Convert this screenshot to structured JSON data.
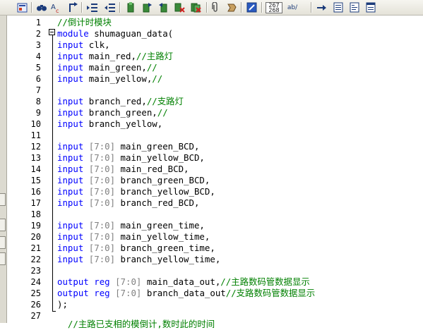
{
  "toolbar": {
    "buttons": [
      {
        "name": "compile-icon"
      },
      {
        "name": "find-icon"
      },
      {
        "name": "find-replace-icon"
      },
      {
        "name": "goto-icon"
      },
      {
        "name": "indent-icon"
      },
      {
        "name": "outdent-icon"
      },
      {
        "name": "bookmark-toggle-icon"
      },
      {
        "name": "bookmark-next-icon"
      },
      {
        "name": "bookmark-prev-icon"
      },
      {
        "name": "bookmark-clear-icon"
      },
      {
        "name": "bookmark-clear-all-icon"
      },
      {
        "name": "attach-icon"
      },
      {
        "name": "insert-icon"
      },
      {
        "name": "edit-icon"
      },
      {
        "name": "number-format-button",
        "text1": "267",
        "text2": "268"
      },
      {
        "name": "abbrev-button",
        "text": "ab/"
      },
      {
        "name": "arrow-right-icon"
      },
      {
        "name": "list-icon"
      },
      {
        "name": "list-alt-icon"
      },
      {
        "name": "doc-icon"
      }
    ]
  },
  "editor": {
    "line_numbers": [
      "1",
      "2",
      "3",
      "4",
      "5",
      "6",
      "7",
      "8",
      "9",
      "10",
      "11",
      "12",
      "13",
      "14",
      "15",
      "16",
      "17",
      "18",
      "19",
      "20",
      "21",
      "22",
      "23",
      "24",
      "25",
      "26",
      "27"
    ],
    "lines": [
      {
        "n": "1",
        "parts": [
          {
            "t": "//倒计时模块",
            "c": "cm"
          }
        ]
      },
      {
        "n": "2",
        "parts": [
          {
            "t": "module",
            "c": "kw"
          },
          {
            "t": " shumaguan_data(",
            "c": "ty"
          }
        ]
      },
      {
        "n": "3",
        "parts": [
          {
            "t": "input",
            "c": "kw"
          },
          {
            "t": " clk,",
            "c": "ty"
          }
        ]
      },
      {
        "n": "4",
        "parts": [
          {
            "t": "input",
            "c": "kw"
          },
          {
            "t": " main_red,",
            "c": "ty"
          },
          {
            "t": "//主路灯",
            "c": "cm"
          }
        ]
      },
      {
        "n": "5",
        "parts": [
          {
            "t": "input",
            "c": "kw"
          },
          {
            "t": " main_green,",
            "c": "ty"
          },
          {
            "t": "//",
            "c": "cm"
          }
        ]
      },
      {
        "n": "6",
        "parts": [
          {
            "t": "input",
            "c": "kw"
          },
          {
            "t": " main_yellow,",
            "c": "ty"
          },
          {
            "t": "//",
            "c": "cm"
          }
        ]
      },
      {
        "n": "7",
        "parts": []
      },
      {
        "n": "8",
        "parts": [
          {
            "t": "input",
            "c": "kw"
          },
          {
            "t": " branch_red,",
            "c": "ty"
          },
          {
            "t": "//支路灯",
            "c": "cm"
          }
        ]
      },
      {
        "n": "9",
        "parts": [
          {
            "t": "input",
            "c": "kw"
          },
          {
            "t": " branch_green,",
            "c": "ty"
          },
          {
            "t": "//",
            "c": "cm"
          }
        ]
      },
      {
        "n": "10",
        "parts": [
          {
            "t": "input",
            "c": "kw"
          },
          {
            "t": " branch_yellow,",
            "c": "ty"
          }
        ]
      },
      {
        "n": "11",
        "parts": []
      },
      {
        "n": "12",
        "parts": [
          {
            "t": "input",
            "c": "kw"
          },
          {
            "t": " [7:0]",
            "c": "br"
          },
          {
            "t": " main_green_BCD,",
            "c": "ty"
          }
        ]
      },
      {
        "n": "13",
        "parts": [
          {
            "t": "input",
            "c": "kw"
          },
          {
            "t": " [7:0]",
            "c": "br"
          },
          {
            "t": " main_yellow_BCD,",
            "c": "ty"
          }
        ]
      },
      {
        "n": "14",
        "parts": [
          {
            "t": "input",
            "c": "kw"
          },
          {
            "t": " [7:0]",
            "c": "br"
          },
          {
            "t": " main_red_BCD,",
            "c": "ty"
          }
        ]
      },
      {
        "n": "15",
        "parts": [
          {
            "t": "input",
            "c": "kw"
          },
          {
            "t": " [7:0]",
            "c": "br"
          },
          {
            "t": " branch_green_BCD,",
            "c": "ty"
          }
        ]
      },
      {
        "n": "16",
        "parts": [
          {
            "t": "input",
            "c": "kw"
          },
          {
            "t": " [7:0]",
            "c": "br"
          },
          {
            "t": " branch_yellow_BCD,",
            "c": "ty"
          }
        ]
      },
      {
        "n": "17",
        "parts": [
          {
            "t": "input",
            "c": "kw"
          },
          {
            "t": " [7:0]",
            "c": "br"
          },
          {
            "t": " branch_red_BCD,",
            "c": "ty"
          }
        ]
      },
      {
        "n": "18",
        "parts": []
      },
      {
        "n": "19",
        "parts": [
          {
            "t": "input",
            "c": "kw"
          },
          {
            "t": " [7:0]",
            "c": "br"
          },
          {
            "t": " main_green_time,",
            "c": "ty"
          }
        ]
      },
      {
        "n": "20",
        "parts": [
          {
            "t": "input",
            "c": "kw"
          },
          {
            "t": " [7:0]",
            "c": "br"
          },
          {
            "t": " main_yellow_time,",
            "c": "ty"
          }
        ]
      },
      {
        "n": "21",
        "parts": [
          {
            "t": "input",
            "c": "kw"
          },
          {
            "t": " [7:0]",
            "c": "br"
          },
          {
            "t": " branch_green_time,",
            "c": "ty"
          }
        ]
      },
      {
        "n": "22",
        "parts": [
          {
            "t": "input",
            "c": "kw"
          },
          {
            "t": " [7:0]",
            "c": "br"
          },
          {
            "t": " branch_yellow_time,",
            "c": "ty"
          }
        ]
      },
      {
        "n": "23",
        "parts": []
      },
      {
        "n": "24",
        "parts": [
          {
            "t": "output",
            "c": "kw"
          },
          {
            "t": " ",
            "c": "ty"
          },
          {
            "t": "reg",
            "c": "kw"
          },
          {
            "t": " [7:0]",
            "c": "br"
          },
          {
            "t": " main_data_out,",
            "c": "ty"
          },
          {
            "t": "//主路数码管数据显示",
            "c": "cm"
          }
        ]
      },
      {
        "n": "25",
        "parts": [
          {
            "t": "output",
            "c": "kw"
          },
          {
            "t": " ",
            "c": "ty"
          },
          {
            "t": "reg",
            "c": "kw"
          },
          {
            "t": " [7:0]",
            "c": "br"
          },
          {
            "t": " branch_data_out",
            "c": "ty"
          },
          {
            "t": "//支路数码管数据显示",
            "c": "cm"
          }
        ]
      },
      {
        "n": "26",
        "parts": [
          {
            "t": ");",
            "c": "ty"
          }
        ]
      },
      {
        "n": "27",
        "parts": []
      }
    ],
    "partial_line": "  //主路已支相的模倒计,数时此的时间"
  }
}
